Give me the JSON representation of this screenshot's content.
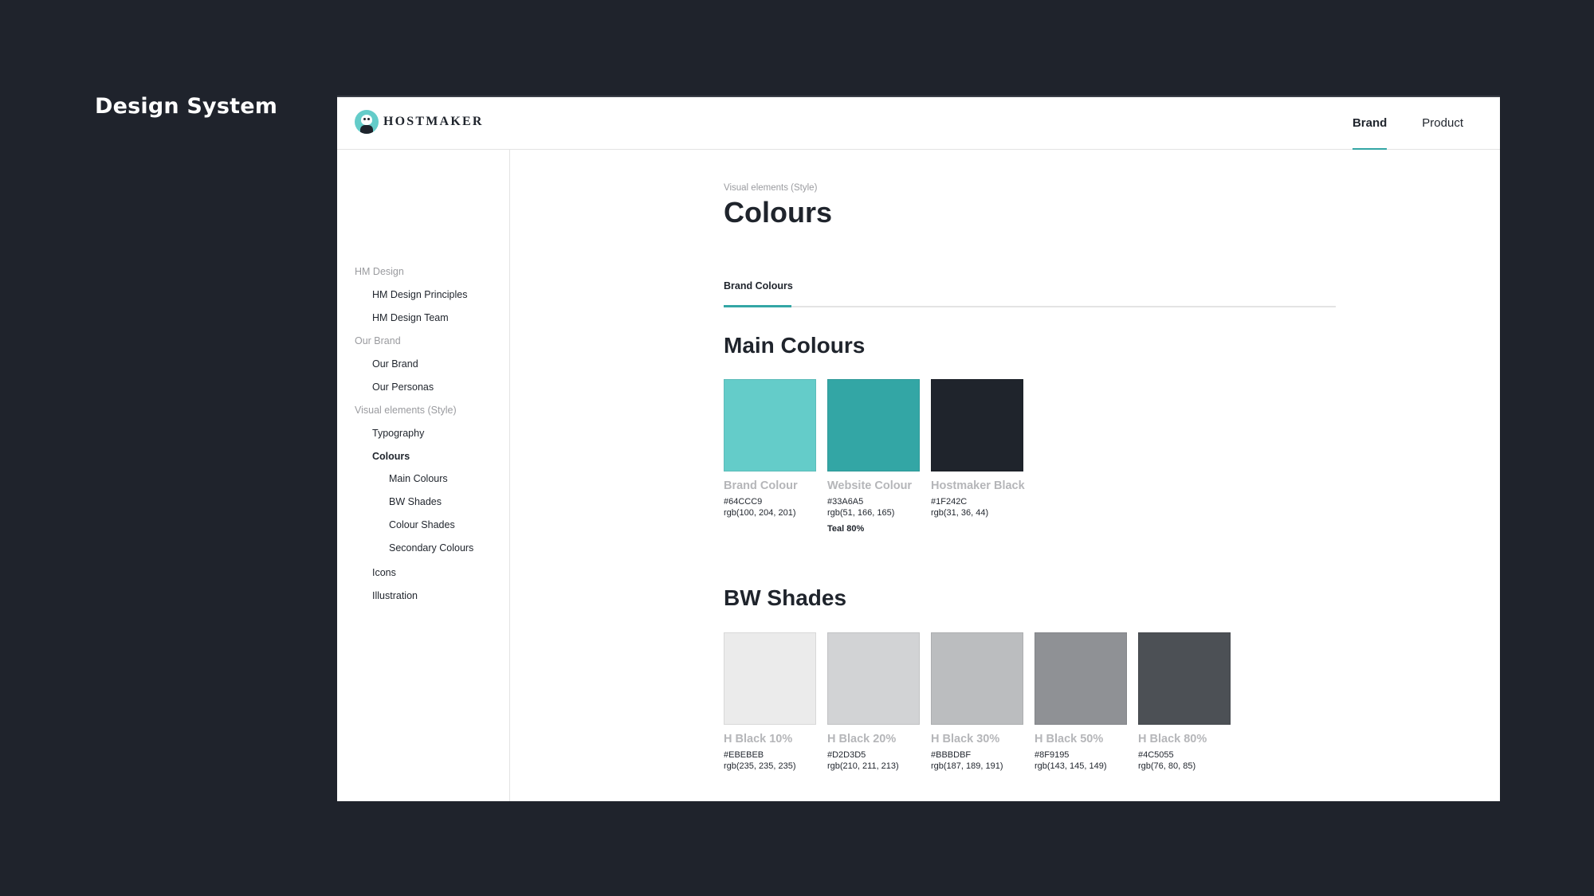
{
  "page": {
    "title": "Design System"
  },
  "header": {
    "logo_text": "HOSTMAKER",
    "nav": [
      {
        "label": "Brand",
        "active": true
      },
      {
        "label": "Product",
        "active": false
      }
    ]
  },
  "sidebar": {
    "items": [
      {
        "label": "HM Design",
        "type": "group"
      },
      {
        "label": "HM Design Principles",
        "type": "item"
      },
      {
        "label": "HM Design Team",
        "type": "item"
      },
      {
        "label": "Our Brand",
        "type": "group"
      },
      {
        "label": "Our Brand",
        "type": "item"
      },
      {
        "label": "Our Personas",
        "type": "item"
      },
      {
        "label": "Visual elements (Style)",
        "type": "group"
      },
      {
        "label": "Typography",
        "type": "item"
      },
      {
        "label": "Colours",
        "type": "item",
        "active": true
      },
      {
        "label": "Main Colours",
        "type": "subitem"
      },
      {
        "label": "BW Shades",
        "type": "subitem"
      },
      {
        "label": "Colour Shades",
        "type": "subitem"
      },
      {
        "label": "Secondary Colours",
        "type": "subitem"
      },
      {
        "label": "Icons",
        "type": "item"
      },
      {
        "label": "Illustration",
        "type": "item"
      }
    ]
  },
  "main": {
    "breadcrumb": "Visual elements (Style)",
    "heading": "Colours",
    "tab": "Brand Colours",
    "sections": [
      {
        "title": "Main Colours",
        "swatches": [
          {
            "name": "Brand Colour",
            "hex": "#64CCC9",
            "rgb": "rgb(100, 204, 201)",
            "color": "#64CCC9"
          },
          {
            "name": "Website Colour",
            "hex": "#33A6A5",
            "rgb": "rgb(51, 166, 165)",
            "color": "#33A6A5",
            "note": "Teal 80%"
          },
          {
            "name": "Hostmaker Black",
            "hex": "#1F242C",
            "rgb": "rgb(31, 36, 44)",
            "color": "#1F242C"
          }
        ]
      },
      {
        "title": "BW Shades",
        "swatches": [
          {
            "name": "H Black 10%",
            "hex": "#EBEBEB",
            "rgb": "rgb(235, 235, 235)",
            "color": "#EBEBEB"
          },
          {
            "name": "H Black 20%",
            "hex": "#D2D3D5",
            "rgb": "rgb(210, 211, 213)",
            "color": "#D2D3D5"
          },
          {
            "name": "H Black 30%",
            "hex": "#BBBDBF",
            "rgb": "rgb(187, 189, 191)",
            "color": "#BBBDBF"
          },
          {
            "name": "H Black 50%",
            "hex": "#8F9195",
            "rgb": "rgb(143, 145, 149)",
            "color": "#8F9195"
          },
          {
            "name": "H Black 80%",
            "hex": "#4C5055",
            "rgb": "rgb(76, 80, 85)",
            "color": "#4C5055"
          }
        ]
      }
    ]
  }
}
